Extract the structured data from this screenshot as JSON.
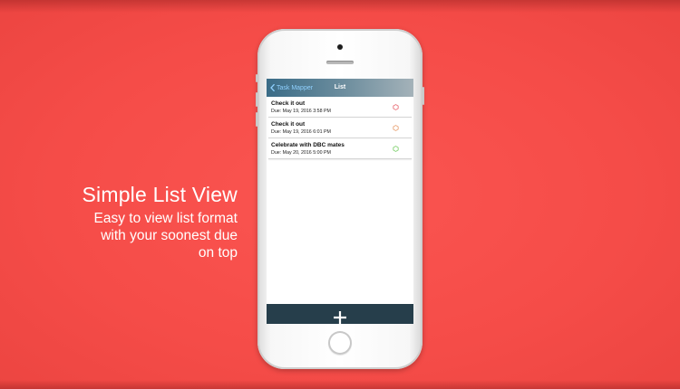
{
  "promo": {
    "title": "Simple List View",
    "desc_line1": "Easy to view list format",
    "desc_line2": "with your soonest due",
    "desc_line3": "on top"
  },
  "app": {
    "nav": {
      "back_label": "Task Mapper",
      "title": "List"
    },
    "tasks": [
      {
        "name": "Check it out",
        "due": "Due: May 19, 2016 3:58 PM",
        "status_color": "#e86a72"
      },
      {
        "name": "Check it out",
        "due": "Due: May 19, 2016 6:01 PM",
        "status_color": "#e8a070"
      },
      {
        "name": "Celebrate with DBC mates",
        "due": "Due: May 20, 2016 5:00 PM",
        "status_color": "#7ccf6a"
      }
    ],
    "add_icon": "plus-icon"
  },
  "colors": {
    "background": "#f54c48",
    "navbar": "#3b6c87",
    "bottom_bar": "#263e4b",
    "back_link": "#8fd0ff"
  }
}
